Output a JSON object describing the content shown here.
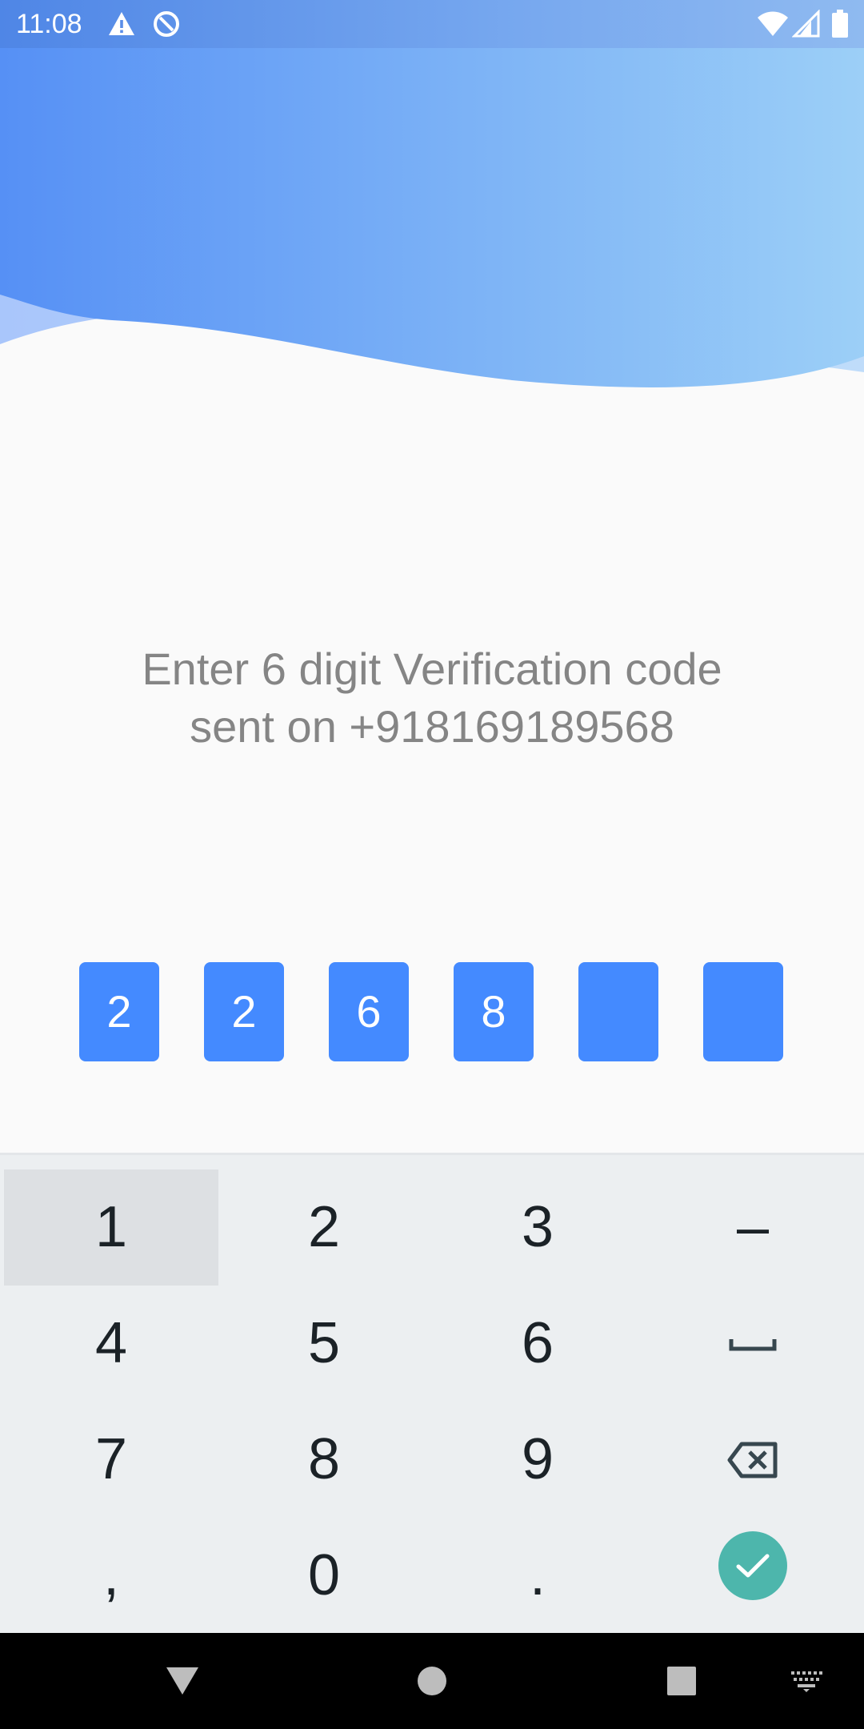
{
  "status_bar": {
    "time": "11:08",
    "icons": [
      "warning-icon",
      "data-saver-icon",
      "wifi-icon",
      "cellular-signal-icon",
      "battery-icon"
    ]
  },
  "colors": {
    "accent": "#448aff",
    "header_gradient_start": "#5690f5",
    "header_gradient_end": "#9ccff7",
    "instruction_text": "#858585",
    "keyboard_bg": "#eceff1",
    "done_button": "#4db6ac"
  },
  "instruction": {
    "line1": "Enter 6 digit Verification code",
    "line2": "sent on +918169189568"
  },
  "otp": {
    "digits": [
      "2",
      "2",
      "6",
      "8",
      "",
      ""
    ]
  },
  "keyboard": {
    "keys": {
      "k1": "1",
      "k2": "2",
      "k3": "3",
      "k_dash": "–",
      "k4": "4",
      "k5": "5",
      "k6": "6",
      "k7": "7",
      "k8": "8",
      "k9": "9",
      "k_comma": ",",
      "k0": "0",
      "k_period": "."
    },
    "icons": [
      "space-icon",
      "backspace-icon",
      "done-check-icon"
    ],
    "pressed_key": "1"
  },
  "nav_bar": {
    "icons": [
      "back-icon",
      "home-icon",
      "recents-icon",
      "keyboard-switch-icon"
    ]
  }
}
